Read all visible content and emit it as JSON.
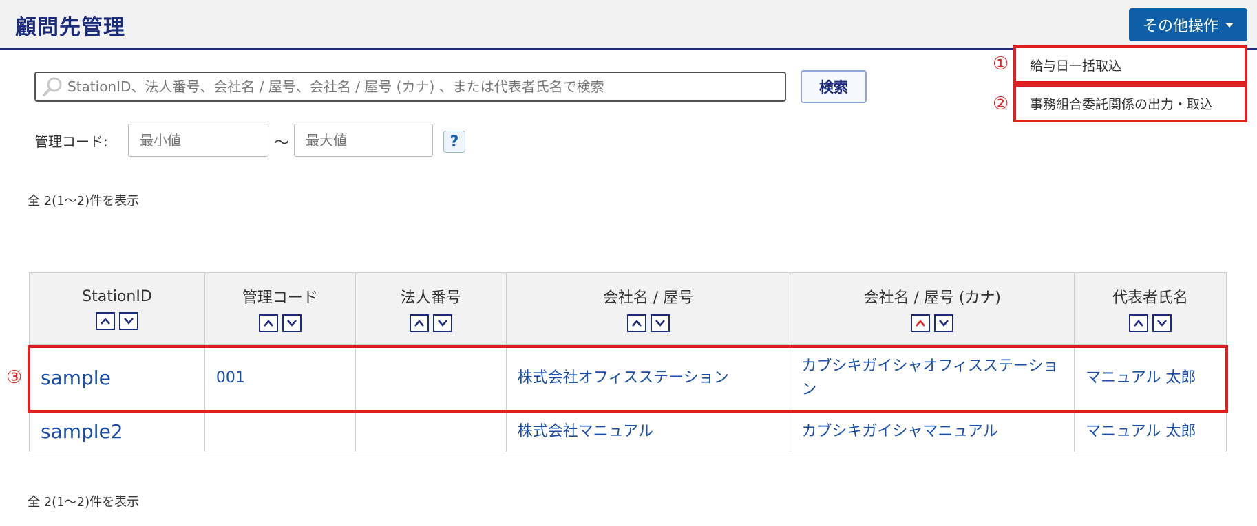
{
  "header": {
    "title": "顧問先管理",
    "other_ops_label": "その他操作"
  },
  "dropdown": {
    "items": [
      {
        "marker": "①",
        "label": "給与日一括取込"
      },
      {
        "marker": "②",
        "label": "事務組合委託関係の出力・取込"
      }
    ]
  },
  "search": {
    "placeholder": "StationID、法人番号、会社名 / 屋号、会社名 / 屋号 (カナ) 、または代表者氏名で検索",
    "value": "",
    "button_label": "検索"
  },
  "management_code": {
    "label": "管理コード:",
    "min_placeholder": "最小値",
    "max_placeholder": "最大値",
    "separator": "～",
    "help_label": "?"
  },
  "result_count_top": "全 2(1～2)件を表示",
  "result_count_bottom": "全 2(1～2)件を表示",
  "row_marker": "③",
  "table": {
    "columns": [
      {
        "label": "StationID",
        "sort_up_active": false
      },
      {
        "label": "管理コード",
        "sort_up_active": false
      },
      {
        "label": "法人番号",
        "sort_up_active": false
      },
      {
        "label": "会社名 / 屋号",
        "sort_up_active": false
      },
      {
        "label": "会社名 / 屋号 (カナ)",
        "sort_up_active": true
      },
      {
        "label": "代表者氏名",
        "sort_up_active": false
      }
    ],
    "rows": [
      {
        "station_id": "sample",
        "code": "001",
        "corp_no": "",
        "company": "株式会社オフィスステーション",
        "company_kana": "カブシキガイシャオフィスステーション",
        "representative": "マニュアル 太郎"
      },
      {
        "station_id": "sample2",
        "code": "",
        "corp_no": "",
        "company": "株式会社マニュアル",
        "company_kana": "カブシキガイシャマニュアル",
        "representative": "マニュアル 太郎"
      }
    ]
  },
  "colors": {
    "brand_navy": "#1c2b7a",
    "button_blue": "#0f5fa8",
    "link_blue": "#1a4ea8",
    "highlight_red": "#e02020"
  }
}
